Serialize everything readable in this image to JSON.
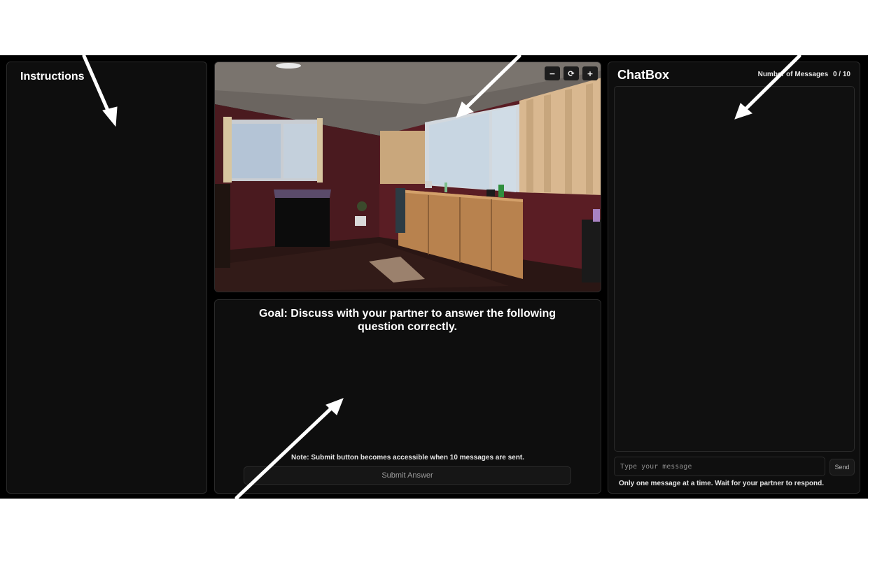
{
  "instructions": {
    "title": "Instructions"
  },
  "viewer": {
    "zoom_out_label": "−",
    "reset_label": "⟳",
    "zoom_in_label": "+"
  },
  "goal": {
    "title": "Goal: Discuss with your partner to answer the following question correctly.",
    "note": "Note: Submit button becomes accessible when 10 messages are sent.",
    "submit_label": "Submit Answer"
  },
  "chat": {
    "title": "ChatBox",
    "count_label": "Number of Messages",
    "count_value": "0 / 10",
    "input_placeholder": "Type your message",
    "send_label": "Send",
    "hint": "Only one message at a time. Wait for your partner to respond."
  },
  "colors": {
    "app_background": "#000000",
    "panel_background": "#0e0e0e",
    "panel_border": "#2a2a2a",
    "annotation_arrow": "#ffffff"
  }
}
